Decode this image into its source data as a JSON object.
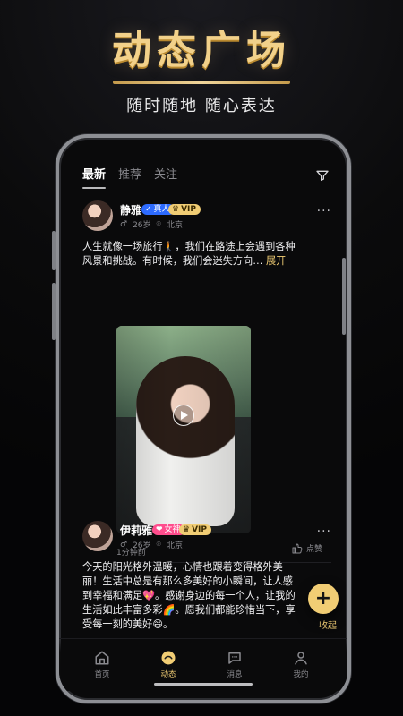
{
  "hero": {
    "title": "动态广场",
    "subtitle": "随时随地  随心表达"
  },
  "top_tabs": [
    {
      "label": "最新",
      "active": true
    },
    {
      "label": "推荐",
      "active": false
    },
    {
      "label": "关注",
      "active": false
    }
  ],
  "posts": [
    {
      "name": "静雅",
      "badges": [
        {
          "type": "real",
          "label": "真人"
        },
        {
          "type": "vip",
          "label": "VIP"
        }
      ],
      "age": "26岁",
      "city": "北京",
      "text_lines": [
        "人生就像一场旅行🚶，我们在路途上会遇到各种",
        "风景和挑战。有时候，我们会迷失方向…"
      ],
      "expand_label": "展开",
      "time_ago": "1分钟前",
      "like_label": "点赞"
    },
    {
      "name": "伊莉雅",
      "badges": [
        {
          "type": "goddess",
          "label": "女神"
        },
        {
          "type": "vip",
          "label": "VIP"
        }
      ],
      "age": "26岁",
      "city": "北京",
      "text_lines": [
        "今天的阳光格外温暖，心情也跟着变得格外美",
        "丽！生活中总是有那么多美好的小瞬间，让人感",
        "到幸福和满足💖。感谢身边的每一个人，让我的",
        "生活如此丰富多彩🌈。愿我们都能珍惜当下，享",
        "受每一刻的美好😄。"
      ]
    }
  ],
  "fab": {
    "label": "+"
  },
  "collapse_label": "收起",
  "bottom_nav": [
    {
      "label": "首页",
      "icon": "home-icon",
      "active": false
    },
    {
      "label": "动态",
      "icon": "moments-icon",
      "active": true
    },
    {
      "label": "消息",
      "icon": "message-icon",
      "active": false
    },
    {
      "label": "我的",
      "icon": "profile-icon",
      "active": false
    }
  ],
  "colors": {
    "accent_gold": "#f1cd74",
    "badge_real_blue": "#2d6bff",
    "badge_goddess_pink": "#ff4d8d",
    "background": "#0b0b0c"
  }
}
